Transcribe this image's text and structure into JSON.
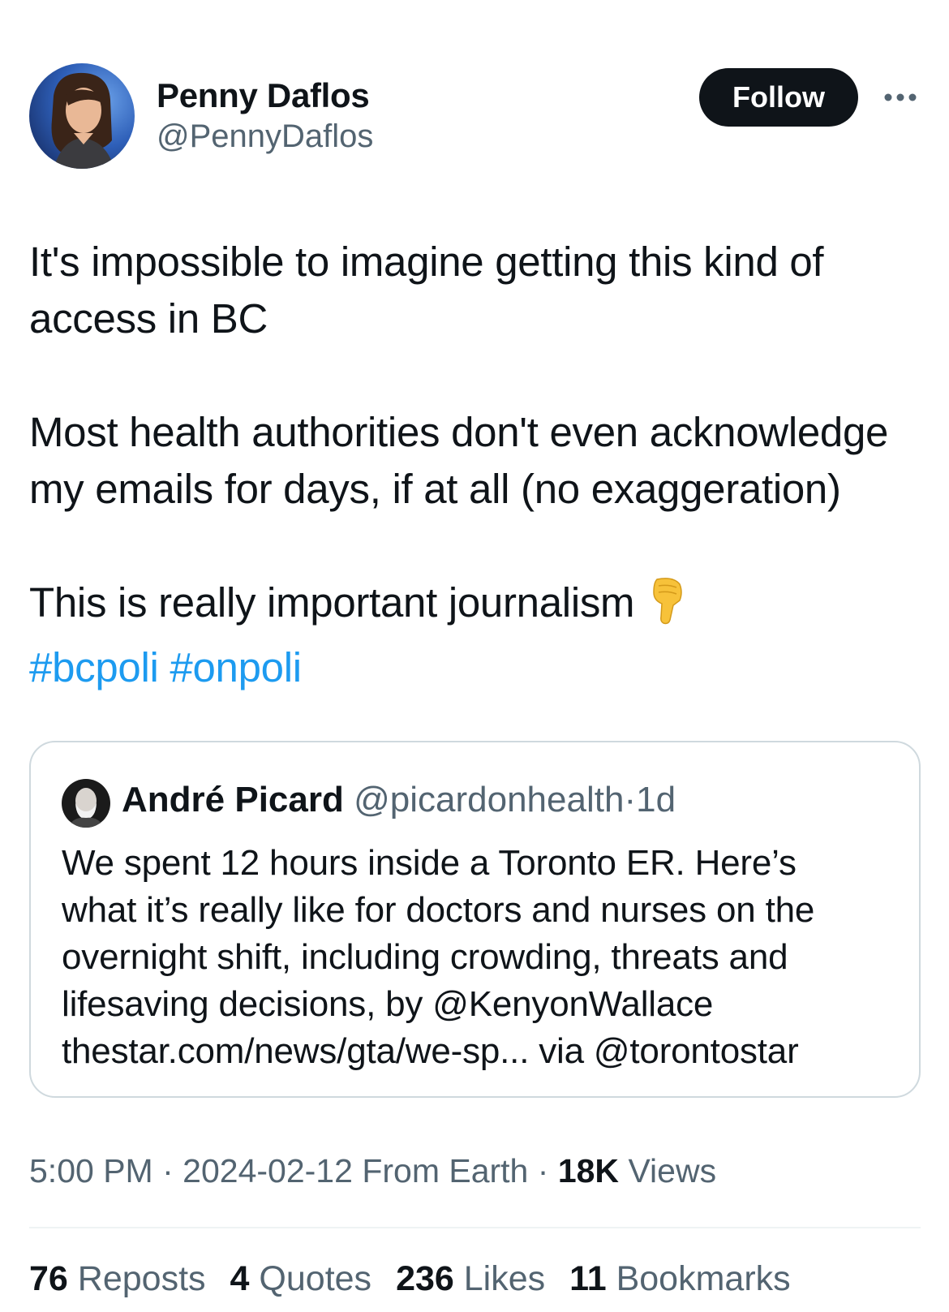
{
  "author": {
    "name": "Penny Daflos",
    "handle": "@PennyDaflos"
  },
  "follow_label": "Follow",
  "more_icon": "more-horizontal-icon",
  "tweet": {
    "lines": [
      "It's impossible to imagine getting this kind of",
      "access in BC",
      "Most health authorities don't even acknowledge",
      "my emails for days, if at all (no exaggeration)",
      "This is really important journalism"
    ],
    "emoji_icon": "backhand-index-pointing-down-icon",
    "hashtags": [
      "#bcpoli",
      "#onpoli"
    ]
  },
  "quote": {
    "name": "André Picard",
    "handle": "@picardonhealth",
    "separator": "·",
    "time": "1d",
    "lines": [
      "We spent 12 hours inside a Toronto ER. Here’s",
      "what it’s really like for doctors and nurses on the",
      "overnight shift, including crowding, threats and",
      "lifesaving decisions, by @KenyonWallace",
      "thestar.com/news/gta/we-sp... via @torontostar"
    ]
  },
  "meta": {
    "time": "5:00 PM",
    "separator": "·",
    "date": "2024-02-12",
    "source": "From Earth",
    "views_count": "18K",
    "views_label": "Views"
  },
  "stats": {
    "reposts_count": "76",
    "reposts_label": "Reposts",
    "quotes_count": "4",
    "quotes_label": "Quotes",
    "likes_count": "236",
    "likes_label": "Likes",
    "bookmarks_count": "11",
    "bookmarks_label": "Bookmarks"
  },
  "colors": {
    "text": "#0f1419",
    "secondary": "#536471",
    "link": "#1d9bf0",
    "border": "#cfd9de",
    "button": "#0f1419"
  }
}
